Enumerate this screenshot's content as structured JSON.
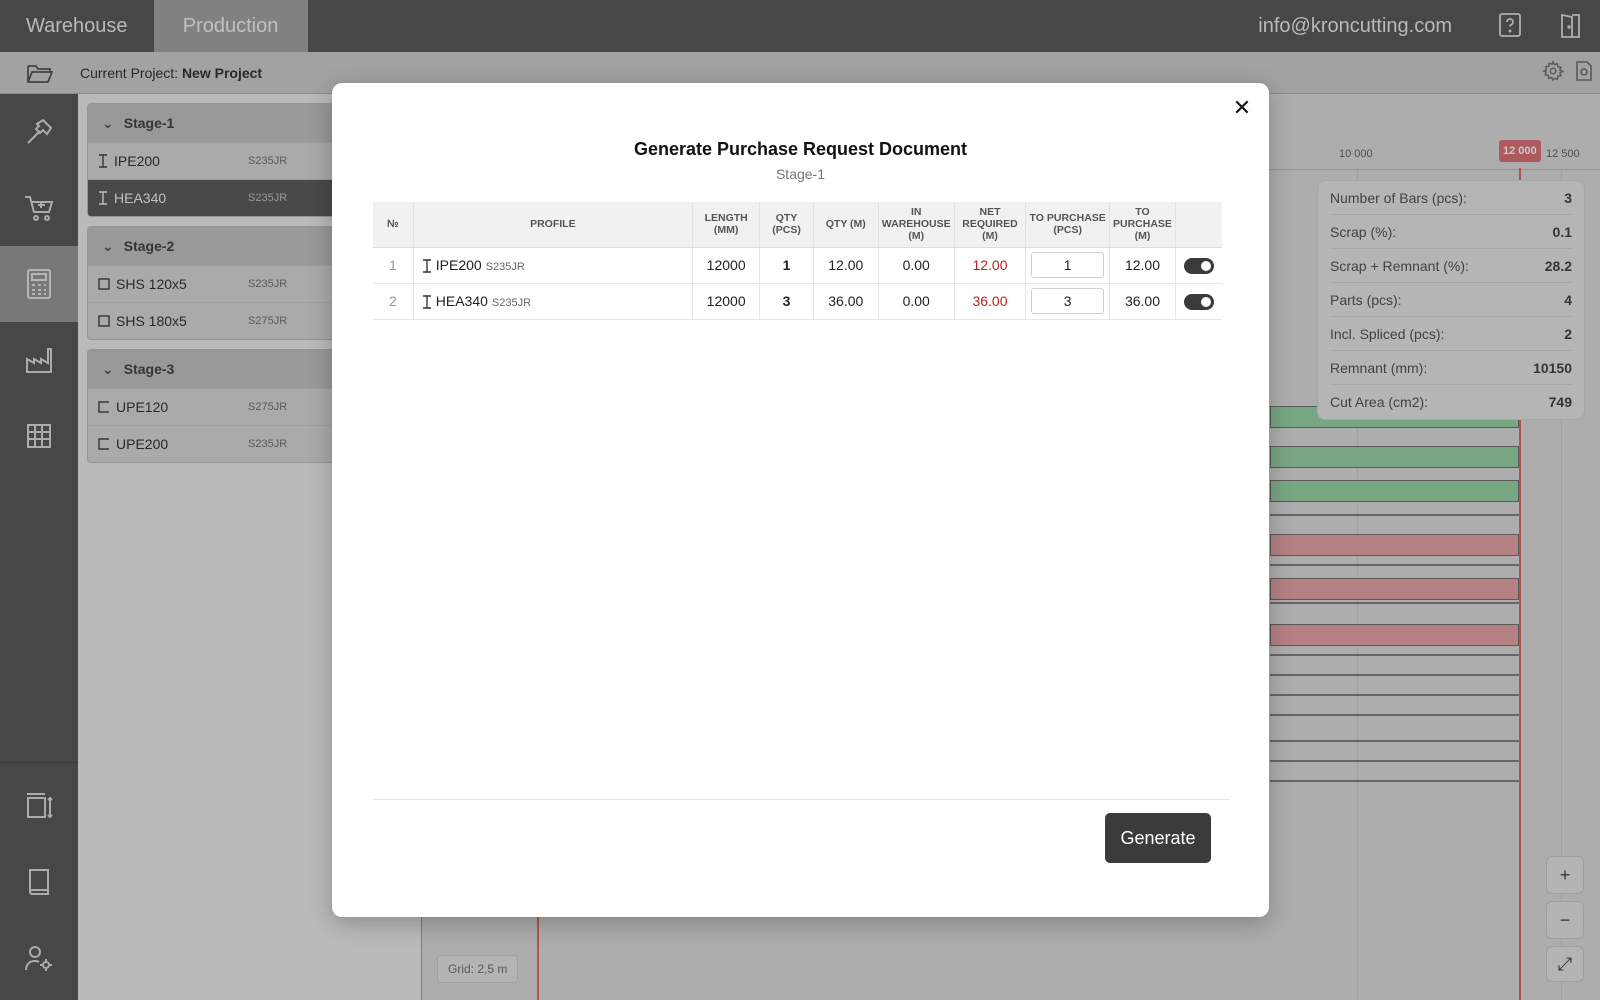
{
  "topbar": {
    "tabs": [
      {
        "label": "Warehouse",
        "active": false
      },
      {
        "label": "Production",
        "active": true
      }
    ],
    "email": "info@kroncutting.com",
    "icons": [
      "help-icon",
      "logout-icon"
    ]
  },
  "subbar": {
    "project_label": "Current Project:",
    "project_name": "New Project",
    "icons": [
      "folder-open-icon",
      "settings-icon",
      "export-icon"
    ]
  },
  "rail": {
    "items": [
      "hammer-icon",
      "cart-icon",
      "calculator-icon",
      "factory-icon",
      "table-icon",
      "dimensions-icon",
      "book-icon",
      "user-settings-icon"
    ],
    "active": "calculator-icon"
  },
  "stages": [
    {
      "name": "Stage-1",
      "items": [
        {
          "profile": "IPE200",
          "grade": "S235JR",
          "icon": "i-beam-icon",
          "selected": false
        },
        {
          "profile": "HEA340",
          "grade": "S235JR",
          "icon": "i-beam-icon",
          "selected": true
        }
      ]
    },
    {
      "name": "Stage-2",
      "items": [
        {
          "profile": "SHS 120x5",
          "grade": "S235JR",
          "icon": "square-tube-icon",
          "selected": false
        },
        {
          "profile": "SHS 180x5",
          "grade": "S275JR",
          "icon": "square-tube-icon",
          "selected": false
        }
      ]
    },
    {
      "name": "Stage-3",
      "items": [
        {
          "profile": "UPE120",
          "grade": "S275JR",
          "icon": "channel-icon",
          "selected": false
        },
        {
          "profile": "UPE200",
          "grade": "S235JR",
          "icon": "channel-icon",
          "selected": false
        }
      ]
    }
  ],
  "ruler": {
    "ticks": [
      "10 000",
      "12 500"
    ],
    "highlight": "12 000"
  },
  "stats": [
    {
      "label": "Number of Bars (pcs):",
      "value": "3"
    },
    {
      "label": "Scrap (%):",
      "value": "0.1"
    },
    {
      "label": "Scrap + Remnant (%):",
      "value": "28.2"
    },
    {
      "label": "Parts (pcs):",
      "value": "4"
    },
    {
      "label": "Incl. Spliced (pcs):",
      "value": "2"
    },
    {
      "label": "Remnant (mm):",
      "value": "10150"
    },
    {
      "label": "Cut Area (cm2):",
      "value": "749"
    }
  ],
  "zoom": {
    "plus": "+",
    "minus": "−",
    "fit": "⤢"
  },
  "grid_label": "Grid: 2,5 m",
  "modal": {
    "title": "Generate Purchase Request Document",
    "subtitle": "Stage-1",
    "close": "✕",
    "columns": [
      "№",
      "Profile",
      "Length (mm)",
      "Qty (pcs)",
      "Qty (m)",
      "In Warehouse (m)",
      "Net Required (m)",
      "To Purchase (pcs)",
      "To Purchase (m)",
      ""
    ],
    "rows": [
      {
        "no": "1",
        "profile": "IPE200",
        "grade": "S235JR",
        "length": "12000",
        "qty_pcs": "1",
        "qty_m": "12.00",
        "in_warehouse": "0.00",
        "net_required": "12.00",
        "to_purchase_pcs": "1",
        "to_purchase_m": "12.00",
        "enabled": true
      },
      {
        "no": "2",
        "profile": "HEA340",
        "grade": "S235JR",
        "length": "12000",
        "qty_pcs": "3",
        "qty_m": "36.00",
        "in_warehouse": "0.00",
        "net_required": "36.00",
        "to_purchase_pcs": "3",
        "to_purchase_m": "36.00",
        "enabled": true
      }
    ],
    "generate_label": "Generate"
  }
}
